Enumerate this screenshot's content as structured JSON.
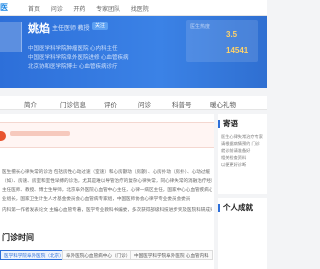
{
  "header": {
    "logo": "医",
    "nav": [
      "首页",
      "问诊",
      "开药",
      "专家团队",
      "找医院"
    ]
  },
  "doctor": {
    "name": "姚焰",
    "title": "主任医师 教授",
    "follow_label": "关注",
    "lines": [
      "中国医学科学院肿瘤医院 心内科主任",
      "中国医学科学院阜外医院进修 心血管疾病",
      "北京协和医学院博士 心血管疾病诊疗"
    ]
  },
  "stats": {
    "label": "医生热度",
    "values": [
      "3.5",
      "14541"
    ]
  },
  "tabs": [
    "简介",
    "门诊信息",
    "评价",
    "问诊",
    "科普号",
    "暖心礼物"
  ],
  "intro_paragraph": [
    "医生擅长心律失常的诊治 包括房性心动过速（室速）和心房颤动（房颤）、心房扑动（房扑）、心动过缓",
    "（如）、房速、房室和室性早搏的诊治，尤其是难以导管治疗的复杂心律失常，同心律失常的消融治疗经验丰富",
    "主任医师、教授、博士生导师，北京阜外医院心血管中心主任，心律一病区主任，国家中心心血管疾病心律失常专",
    "业组长，国家卫生计生人才基金委员会心血管病专家组，中国医师协会心律学专业委员会委员",
    "内科第一作者发表论文 主编心血管专著，医学专业教科书编委，多次获得部级科技进步奖及医院科研成果奖项"
  ],
  "outpatient": {
    "title": "门诊时间",
    "hospitals": [
      "医学科学院阜外医院（北京）",
      "阜外医院心血管病中心（门诊）",
      "中国医学科学院阜外医院 心血管内科"
    ]
  },
  "sidebar": {
    "send_title": "寄语",
    "send_text": [
      "医生心律失常治疗专家",
      "请根据病情预约 门诊",
      "就诊前请准备好",
      "相关检查资料",
      "以便更好诊断"
    ],
    "achievements_title": "个人成就"
  }
}
